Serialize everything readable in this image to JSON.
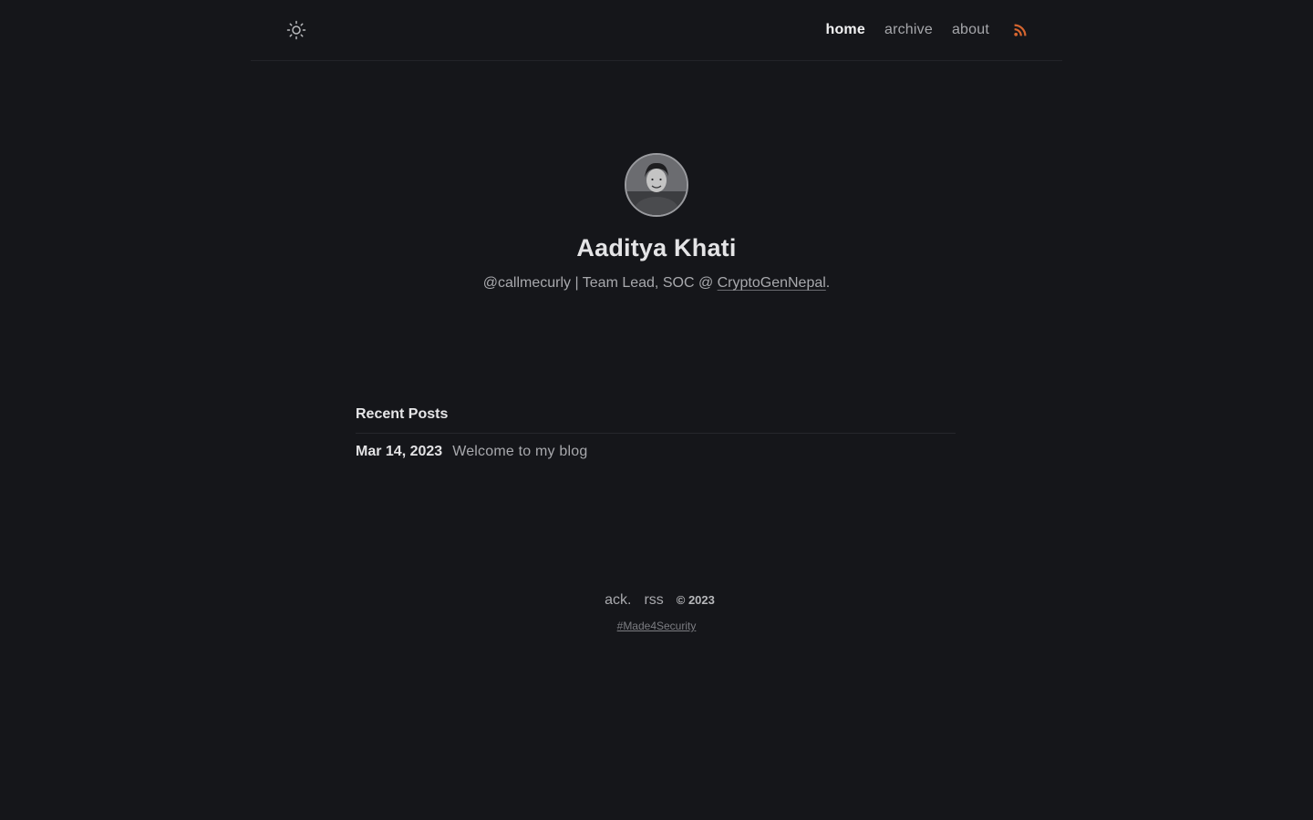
{
  "header": {
    "theme_toggle_icon": "sun-icon",
    "nav": [
      {
        "label": "home",
        "active": true
      },
      {
        "label": "archive",
        "active": false
      },
      {
        "label": "about",
        "active": false
      }
    ],
    "rss_icon": "rss-icon",
    "rss_color": "#d5652f"
  },
  "profile": {
    "name": "Aaditya Khati",
    "bio_prefix": "@callmecurly | Team Lead, SOC @ ",
    "bio_link": "CryptoGenNepal",
    "bio_suffix": "."
  },
  "posts": {
    "title": "Recent Posts",
    "items": [
      {
        "date": "Mar 14, 2023",
        "title": "Welcome to my blog"
      }
    ]
  },
  "footer": {
    "links": [
      "ack.",
      "rss"
    ],
    "copyright": "© 2023",
    "tagline": "#Made4Security"
  },
  "colors": {
    "background": "#15161a",
    "text": "#c9c9cc",
    "accent_rss": "#d5652f"
  }
}
